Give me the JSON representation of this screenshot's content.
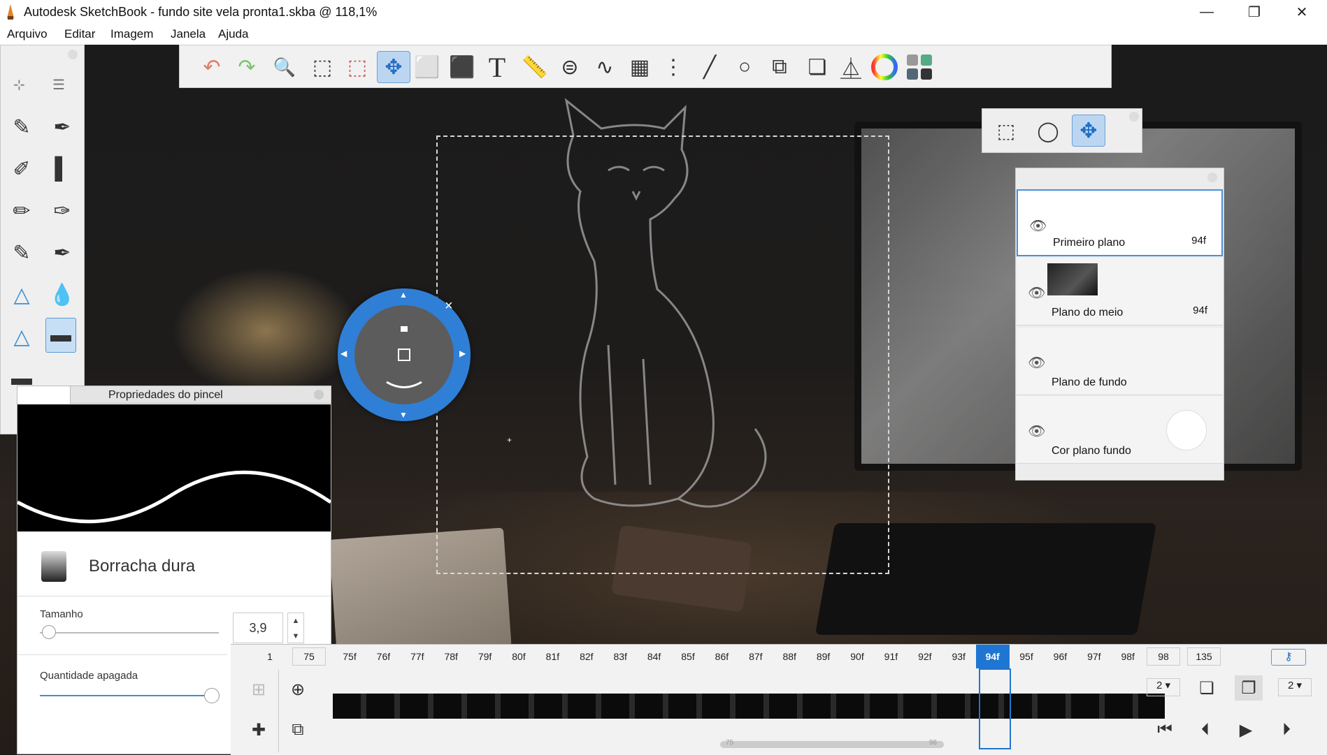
{
  "window": {
    "title": "Autodesk SketchBook - fundo site vela pronta1.skba @ 118,1%",
    "minimize": "—",
    "maximize": "❐",
    "close": "✕"
  },
  "menu": [
    "Arquivo",
    "Editar",
    "Imagem",
    "Janela",
    "Ajuda"
  ],
  "toolbar": {
    "icons": [
      "undo-icon",
      "redo-icon",
      "zoom-icon",
      "select-icon",
      "crop-icon",
      "transform-icon",
      "distort-icon",
      "fill-icon",
      "text-icon",
      "ruler-icon",
      "ellipse-guide-icon",
      "french-curve-icon",
      "perspective-icon",
      "symmetry-icon",
      "stroke-icon",
      "circle-icon",
      "shape-icon",
      "copy-paste-icon",
      "brush-library-icon",
      "color-wheel-icon",
      "palette-icon"
    ],
    "glyphs": [
      "↶",
      "↷",
      "🔍",
      "⬚",
      "⬚",
      "✥",
      "⬜",
      "⬛",
      "T",
      "📏",
      "⊜",
      "∿",
      "▦",
      "⋮",
      "╱",
      "○",
      "⧉",
      "❏",
      "⏅",
      "◎",
      "▦"
    ]
  },
  "selbar": {
    "glyphs": [
      "⬚",
      "◯",
      "✥"
    ]
  },
  "brushes": {
    "glyphs": [
      "✎",
      "✒",
      "✐",
      "▌",
      "✏",
      "✑",
      "✎",
      "✒",
      "△",
      "💧",
      "△",
      "▬",
      "▬"
    ]
  },
  "puck": {
    "close": "×"
  },
  "brush_props": {
    "title": "Propriedades do pincel",
    "brush_name": "Borracha dura",
    "size_label": "Tamanho",
    "size_value": "3,9",
    "size_level": 0.05,
    "amount_label": "Quantidade apagada",
    "amount_level": 1.0
  },
  "layers": [
    {
      "name": "Primeiro plano",
      "frame": "94f",
      "selected": true
    },
    {
      "name": "Plano do meio",
      "frame": "94f",
      "selected": false
    },
    {
      "name": "Plano de fundo",
      "frame": "",
      "selected": false
    },
    {
      "name": "Cor plano fundo",
      "frame": "",
      "selected": false
    }
  ],
  "timeline": {
    "start": "1",
    "start_frame": "75",
    "frames": [
      "75f",
      "76f",
      "77f",
      "78f",
      "79f",
      "80f",
      "81f",
      "82f",
      "83f",
      "84f",
      "85f",
      "86f",
      "87f",
      "88f",
      "89f",
      "90f",
      "91f",
      "92f",
      "93f",
      "94f",
      "95f",
      "96f",
      "97f",
      "98f"
    ],
    "current_frame": "94f",
    "end_frame": "98",
    "total": "135",
    "onion_before": "2",
    "onion_after": "2",
    "scroll_start": "75",
    "scroll_end": "98"
  }
}
